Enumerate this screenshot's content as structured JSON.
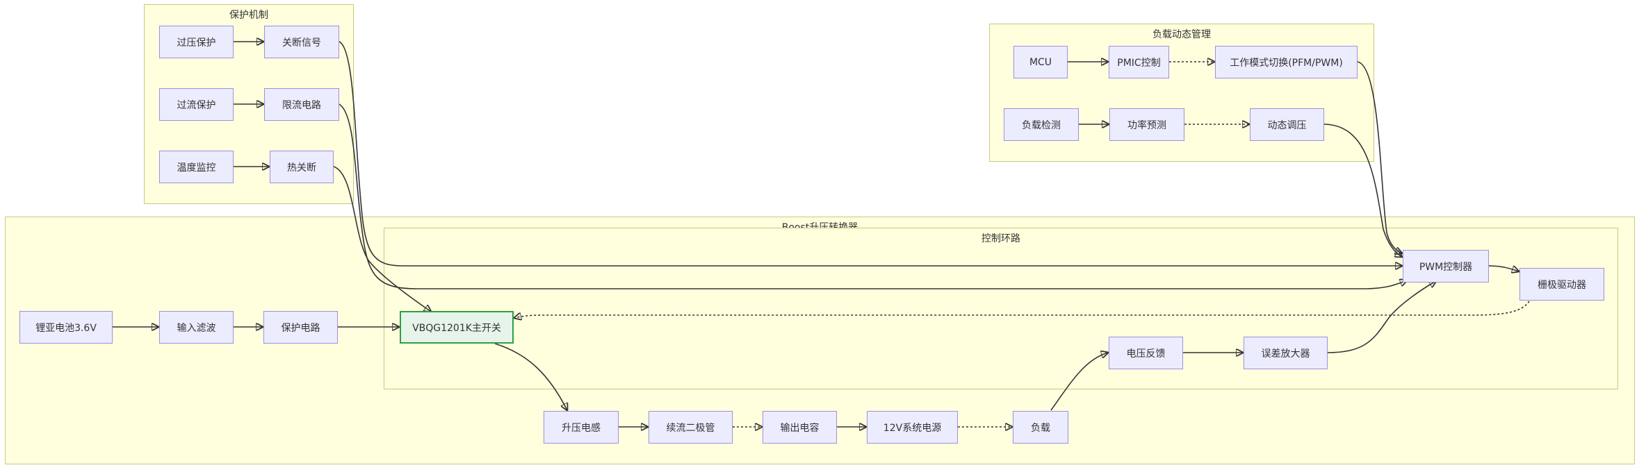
{
  "clusters": {
    "protection": {
      "title": "保护机制"
    },
    "load_mgmt": {
      "title": "负载动态管理"
    },
    "boost": {
      "title": "Boost升压转换器"
    },
    "control": {
      "title": "控制环路"
    }
  },
  "nodes": {
    "overvoltage": "过压保护",
    "shutdown_signal": "关断信号",
    "overcurrent": "过流保护",
    "current_limit": "限流电路",
    "temp_monitor": "温度监控",
    "thermal_shutdown": "热关断",
    "mcu": "MCU",
    "pmic": "PMIC控制",
    "mode_switch": "工作模式切换(PFM/PWM)",
    "load_detect": "负载检测",
    "power_predict": "功率预测",
    "dynamic_regulate": "动态调压",
    "battery": "锂亚电池3.6V",
    "input_filter": "输入滤波",
    "protect_circuit": "保护电路",
    "main_switch": "VBQG1201K主开关",
    "pwm_controller": "PWM控制器",
    "gate_driver": "栅极驱动器",
    "voltage_feedback": "电压反馈",
    "error_amp": "误差放大器",
    "boost_inductor": "升压电感",
    "diode": "续流二极管",
    "output_cap": "输出电容",
    "sys_power": "12V系统电源",
    "load": "负载"
  },
  "colors": {
    "cluster_fill": "#ffffde",
    "cluster_border": "#c9c97a",
    "node_fill": "#ececff",
    "node_border": "#9d8fe0",
    "highlight_fill": "#e6f4ea",
    "highlight_border": "#2e9e44",
    "edge": "#333333"
  }
}
